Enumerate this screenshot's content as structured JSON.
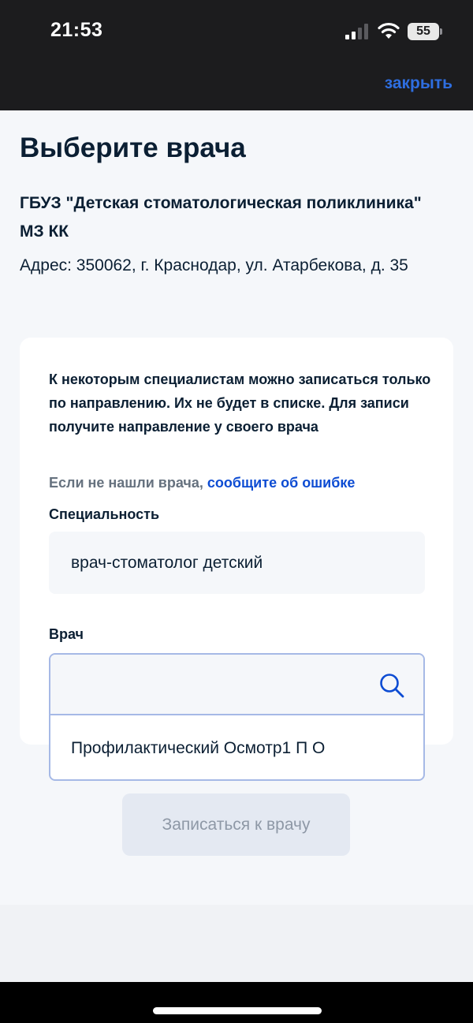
{
  "status_bar": {
    "time": "21:53",
    "battery_level": "55",
    "signal_icon": "cellular-signal-icon",
    "wifi_icon": "wifi-icon"
  },
  "nav": {
    "close_label": "закрыть"
  },
  "page": {
    "title": "Выберите врача",
    "org_name": "ГБУЗ \"Детская стоматологическая поликлиника\" МЗ КК",
    "address": "Адрес: 350062, г. Краснодар, ул. Атарбекова, д. 35"
  },
  "card": {
    "notice": "К некоторым специалистам можно записаться только по направлению. Их не будет в списке. Для записи получите направление у своего врача",
    "report_prefix": "Если не нашли врача, ",
    "report_link": "сообщите об ошибке",
    "specialty_label": "Специальность",
    "specialty_value": "врач-стоматолог детский",
    "doctor_label": "Врач"
  },
  "doctor_search": {
    "value": "",
    "placeholder": "",
    "icon": "search-icon",
    "options": [
      "Профилактический Осмотр1 П О"
    ]
  },
  "submit_label": "Записаться к врачу",
  "colors": {
    "accent": "#0d4cd3",
    "close_link": "#2e6ee0",
    "text": "#0b1f33",
    "muted": "#66727f",
    "background": "#f5f7fa",
    "disabled_button": "#e4e9f2"
  }
}
